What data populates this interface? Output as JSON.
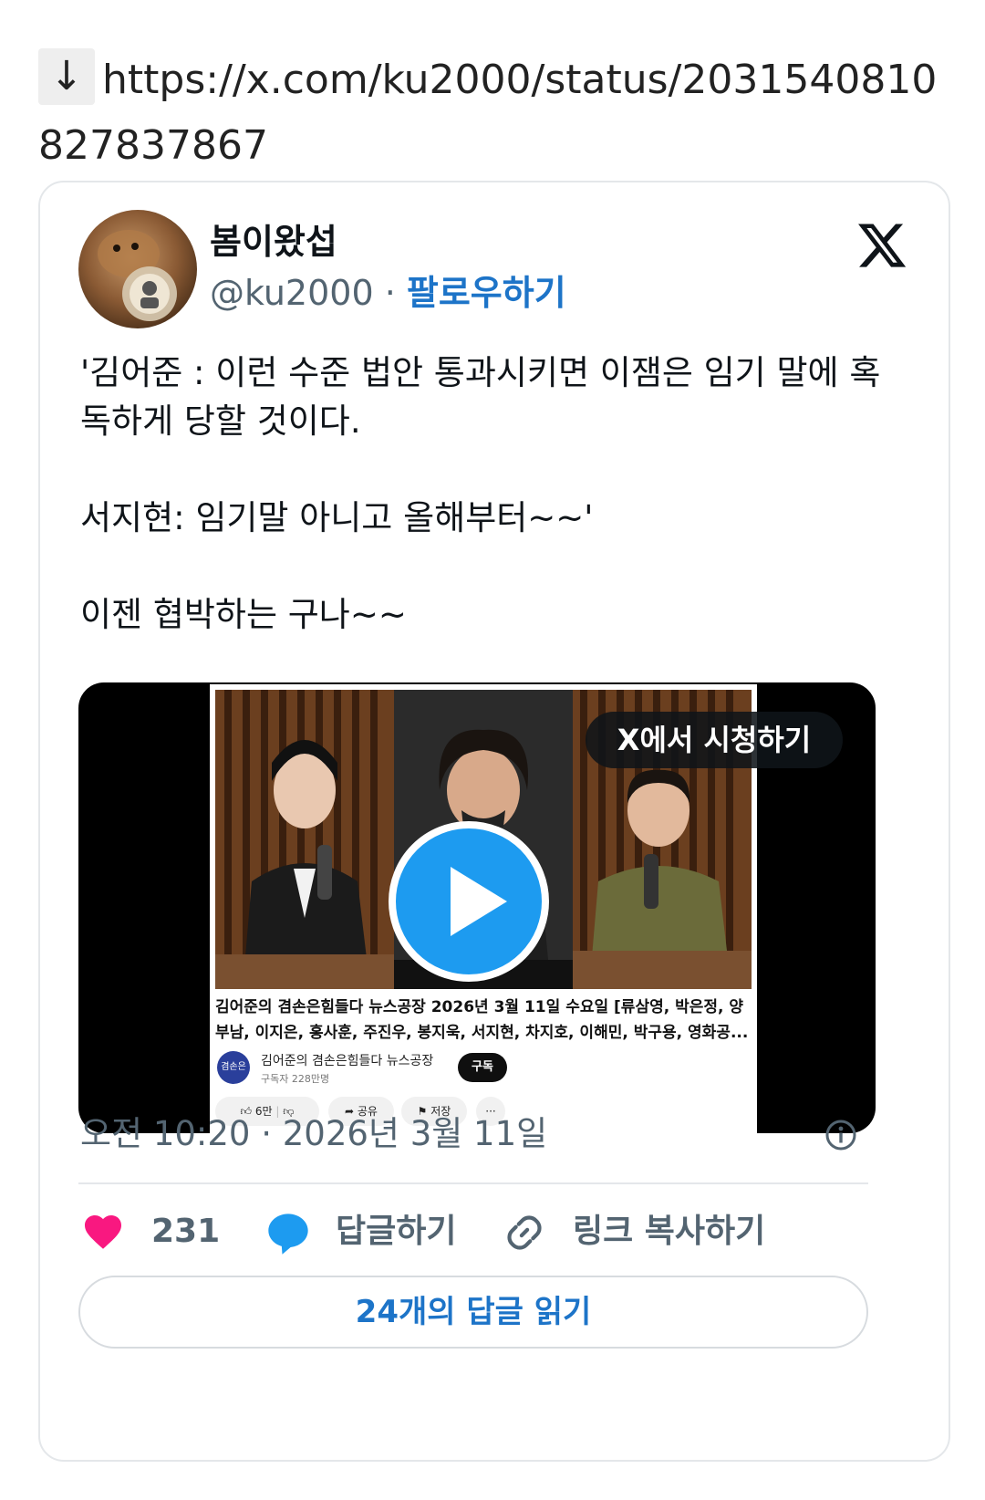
{
  "link": {
    "arrow": "↓",
    "url": "https://x.com/ku2000/status/2031540810827837867"
  },
  "tweet": {
    "display_name": "봄이왔섭",
    "handle": "@ku2000",
    "separator": " · ",
    "follow_label": "팔로우하기",
    "text": "'김어준 : 이런 수준 법안 통과시키면 이잼은 임기 말에 혹독하게 당할 것이다.\n\n서지현: 임기말 아니고 올해부터~~'\n\n이젠 협박하는 구나~~",
    "timestamp": "오전 10:20 · 2026년 3월 11일"
  },
  "video": {
    "watch_label": "X에서 시청하기",
    "title": "김어준의 겸손은힘들다 뉴스공장 2026년 3월 11일 수요일 [류삼영, 박은정, 양부남, 이지은, 홍사훈, 주진우, 봉지욱, 서지현, 차지호, 이해민, 박구용, 영화공...",
    "channel_name": "김어준의 겸손은힘들다 뉴스공장",
    "channel_subs": "구독자 228만명",
    "channel_logo_text": "겸손은",
    "subscribe_label": "구독",
    "like_count": "6만",
    "share_label": "공유",
    "save_label": "저장",
    "more_label": "···"
  },
  "actions": {
    "like_count": "231",
    "reply_label": "답글하기",
    "copy_link_label": "링크 복사하기",
    "read_replies_label": "24개의 답글 읽기"
  },
  "colors": {
    "accent": "#1d74c8",
    "heart": "#f91880",
    "reply_bubble": "#1d9bf0",
    "muted_text": "#536471",
    "border": "#e4e7ea"
  },
  "icons": {
    "like": "heart-icon",
    "reply": "speech-bubble-icon",
    "copy_link": "link-icon",
    "info": "info-icon",
    "brand": "x-logo-icon",
    "play": "play-icon"
  }
}
